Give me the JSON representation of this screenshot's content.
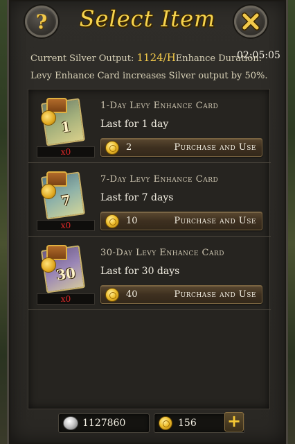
{
  "header": {
    "title": "Select Item",
    "help_icon": "question-mark-icon",
    "close_icon": "close-x-icon",
    "help_glyph": "?"
  },
  "info": {
    "silver_label": "Current Silver Output:",
    "silver_value": "1124/H",
    "duration_label": "Enhance Duration:",
    "duration_value": "02:05:05",
    "description": "Levy Enhance Card increases Silver output by 50%."
  },
  "items": [
    {
      "title": "1-Day Levy Enhance Card",
      "desc": "Last for 1 day",
      "qty": "x0",
      "card_number": "1",
      "cost": "2",
      "button_label": "Purchase and Use"
    },
    {
      "title": "7-Day Levy Enhance Card",
      "desc": "Last for 7 days",
      "qty": "x0",
      "card_number": "7",
      "cost": "10",
      "button_label": "Purchase and Use"
    },
    {
      "title": "30-Day Levy Enhance Card",
      "desc": "Last for 30 days",
      "qty": "x0",
      "card_number": "30",
      "cost": "40",
      "button_label": "Purchase and Use"
    }
  ],
  "footer": {
    "silver_amount": "1127860",
    "gold_amount": "156",
    "plus_glyph": "+"
  },
  "colors": {
    "gold_text": "#f2c94a",
    "title": "#f6d44e",
    "qty_red": "#e02828"
  }
}
